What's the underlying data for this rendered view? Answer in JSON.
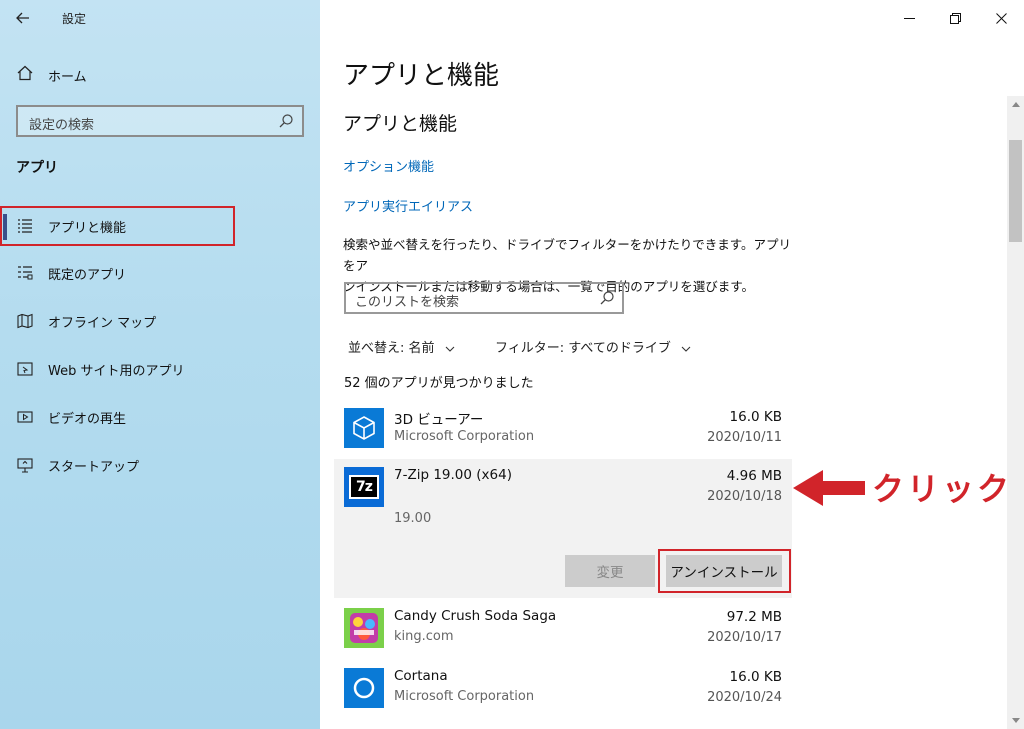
{
  "window": {
    "title": "設定"
  },
  "sidebar": {
    "home_label": "ホーム",
    "search_placeholder": "設定の検索",
    "section_title": "アプリ",
    "items": [
      {
        "label": "アプリと機能",
        "icon": "list-icon",
        "active": true
      },
      {
        "label": "既定のアプリ",
        "icon": "default-apps-icon"
      },
      {
        "label": "オフライン マップ",
        "icon": "map-icon"
      },
      {
        "label": "Web サイト用のアプリ",
        "icon": "web-app-icon"
      },
      {
        "label": "ビデオの再生",
        "icon": "video-icon"
      },
      {
        "label": "スタートアップ",
        "icon": "startup-icon"
      }
    ]
  },
  "main": {
    "page_title": "アプリと機能",
    "sub_title": "アプリと機能",
    "links": [
      "オプション機能",
      "アプリ実行エイリアス"
    ],
    "description_line1": "検索や並べ替えを行ったり、ドライブでフィルターをかけたりできます。アプリをア",
    "description_line2": "ンインストールまたは移動する場合は、一覧で目的のアプリを選びます。",
    "list_search_placeholder": "このリストを検索",
    "sort_label": "並べ替え:",
    "sort_value": "名前",
    "filter_label": "フィルター:",
    "filter_value": "すべてのドライブ",
    "count_text": "52 個のアプリが見つかりました",
    "apps": [
      {
        "name": "3D ビューアー",
        "publisher": "Microsoft Corporation",
        "size": "16.0 KB",
        "date": "2020/10/11",
        "icon": "3d-viewer-icon"
      },
      {
        "name": "7-Zip 19.00 (x64)",
        "version": "19.00",
        "size": "4.96 MB",
        "date": "2020/10/18",
        "icon": "7zip-icon",
        "icon_text": "7z",
        "expanded": true
      },
      {
        "name": "Candy Crush Soda Saga",
        "publisher": "king.com",
        "size": "97.2 MB",
        "date": "2020/10/17",
        "icon": "candy-crush-icon"
      },
      {
        "name": "Cortana",
        "publisher": "Microsoft Corporation",
        "size": "16.0 KB",
        "date": "2020/10/24",
        "icon": "cortana-icon"
      }
    ],
    "modify_label": "変更",
    "uninstall_label": "アンインストール"
  },
  "annotation": {
    "text": "クリック"
  },
  "colors": {
    "accent_link": "#0067b8",
    "highlight": "#d1242a",
    "sidebar_bg": "#b4dcef"
  }
}
